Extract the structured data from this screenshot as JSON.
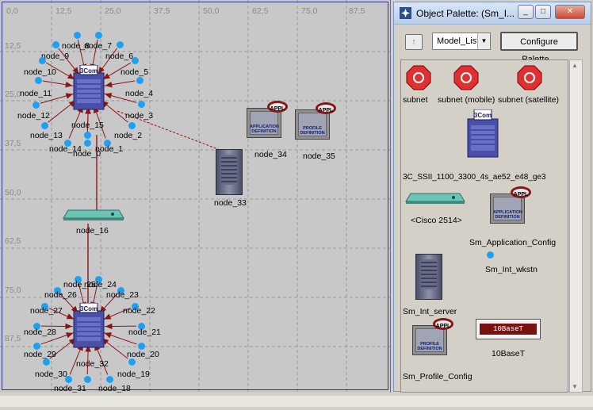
{
  "workspace": {
    "x_ticks": [
      "0,0",
      "12,5",
      "25,0",
      "37,5",
      "50,0",
      "62,5",
      "75,0",
      "87,5"
    ],
    "y_ticks": [
      "12,5",
      "25,0",
      "37,5",
      "50,0",
      "62,5",
      "75,0",
      "87,5"
    ],
    "nodes_top": [
      "node_8",
      "node_7",
      "node_9",
      "node_6",
      "node_10",
      "node_5",
      "node_11",
      "node_4",
      "node_12",
      "node_3",
      "node_13",
      "node_2",
      "node_14",
      "node_1",
      "node_15",
      "node_0"
    ],
    "nodes_bottom": [
      "node_25",
      "node_24",
      "node_26",
      "node_23",
      "node_27",
      "node_22",
      "node_28",
      "node_21",
      "node_29",
      "node_20",
      "node_30",
      "node_19",
      "node_31",
      "node_18",
      "node_32"
    ],
    "node_33": "node_33",
    "node_34": "node_34",
    "node_35": "node_35",
    "node_16": "node_16",
    "appl_badge": "APPL",
    "app_def_caption": "APPLICATION DEFINITION",
    "profile_def_caption": "PROFILE DEFINITION",
    "switch_brand": "3Com"
  },
  "palette": {
    "title": "Object Palette: (Sm_I...",
    "model_list": "Model_List",
    "configure_button": "Configure Palette...",
    "items": {
      "subnet": "subnet",
      "subnet_mobile": "subnet (mobile)",
      "subnet_satellite": "subnet (satellite)",
      "switch": "3C_SSII_1100_3300_4s_ae52_e48_ge3",
      "cisco": "<Cisco 2514>",
      "app_config": "Sm_Application_Config",
      "wkstn": "Sm_Int_wkstn",
      "server": "Sm_Int_server",
      "profile_config": "Sm_Profile_Config",
      "tenbaset": "10BaseT",
      "tenbaset_badge": "10BaseT"
    }
  },
  "colors": {
    "accent_link": "#8b1414",
    "node_dot": "#1ea0f0",
    "workspace_bg": "#c8c8c8"
  }
}
